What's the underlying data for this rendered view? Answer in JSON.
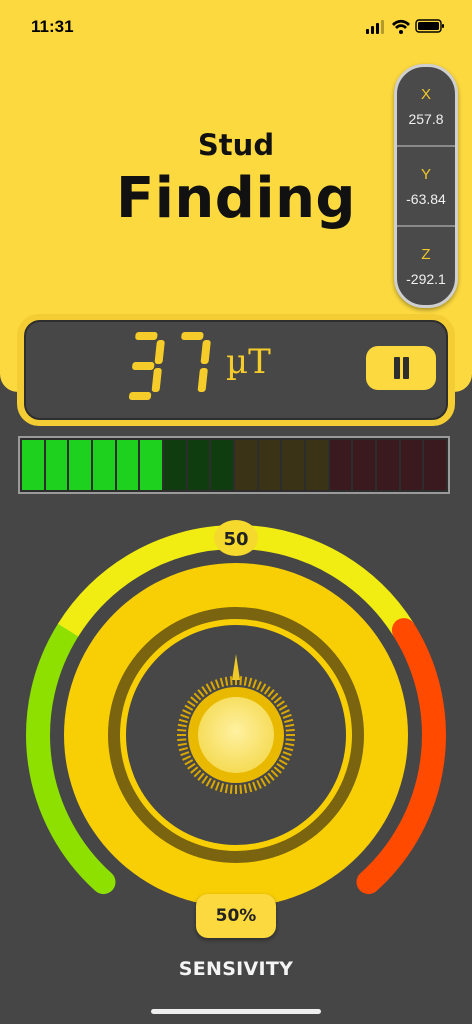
{
  "status_bar": {
    "time": "11:31"
  },
  "header": {
    "title_line1": "Stud",
    "title_line2": "Finding"
  },
  "axes": [
    {
      "label": "X",
      "value": "257.8"
    },
    {
      "label": "Y",
      "value": "-63.84"
    },
    {
      "label": "Z",
      "value": "-292.1"
    }
  ],
  "readout": {
    "value": "37",
    "unit": "µT"
  },
  "meter": {
    "segments_total": 18,
    "segments_lit": 6,
    "colors_lit": [
      "#1fd11f",
      "#1fd11f",
      "#1fd11f",
      "#1fd11f",
      "#1fd11f",
      "#1fd11f"
    ],
    "colors_dim": [
      "#103d10",
      "#103d10",
      "#103d10",
      "#3a3316",
      "#3a3316",
      "#3a3316",
      "#3a3316",
      "#3a1a1e",
      "#3a1a1e",
      "#3a1a1e",
      "#3a1a1e",
      "#3a1a1e"
    ]
  },
  "dial": {
    "top_value": "50",
    "sensitivity_percent": "50%",
    "sensitivity_fraction": 0.5
  },
  "footer": {
    "label": "SENSIVITY"
  },
  "colors": {
    "accent": "#fcd93f",
    "background": "#464646",
    "green": "#8ee000",
    "red": "#ff4a00"
  }
}
